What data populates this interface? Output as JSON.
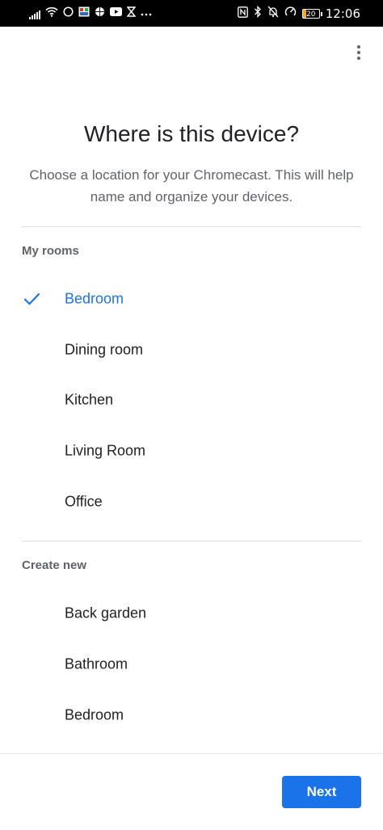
{
  "status_bar": {
    "time": "12:06",
    "battery": "20",
    "left_icons": [
      "signal-icon",
      "wifi-icon",
      "circle-icon",
      "gallery-icon",
      "basketball-icon",
      "youtube-icon",
      "hourglass-icon",
      "more-notifications-icon"
    ],
    "right_icons": [
      "nfc-icon",
      "bluetooth-icon",
      "notifications-off-icon",
      "data-saver-icon"
    ]
  },
  "header": {
    "menu_icon": "more-vert-icon",
    "title": "Where is this device?",
    "subtitle": "Choose a location for your Chromecast. This will help name and organize your devices."
  },
  "my_rooms": {
    "label": "My rooms",
    "items": [
      {
        "label": "Bedroom",
        "selected": true
      },
      {
        "label": "Dining room",
        "selected": false
      },
      {
        "label": "Kitchen",
        "selected": false
      },
      {
        "label": "Living Room",
        "selected": false
      },
      {
        "label": "Office",
        "selected": false
      }
    ]
  },
  "create_new": {
    "label": "Create new",
    "items": [
      {
        "label": "Back garden"
      },
      {
        "label": "Bathroom"
      },
      {
        "label": "Bedroom"
      }
    ]
  },
  "footer": {
    "next_label": "Next"
  },
  "colors": {
    "accent": "#1a73e8",
    "text_primary": "#202124",
    "text_secondary": "#5f6368",
    "divider": "#dadce0"
  }
}
